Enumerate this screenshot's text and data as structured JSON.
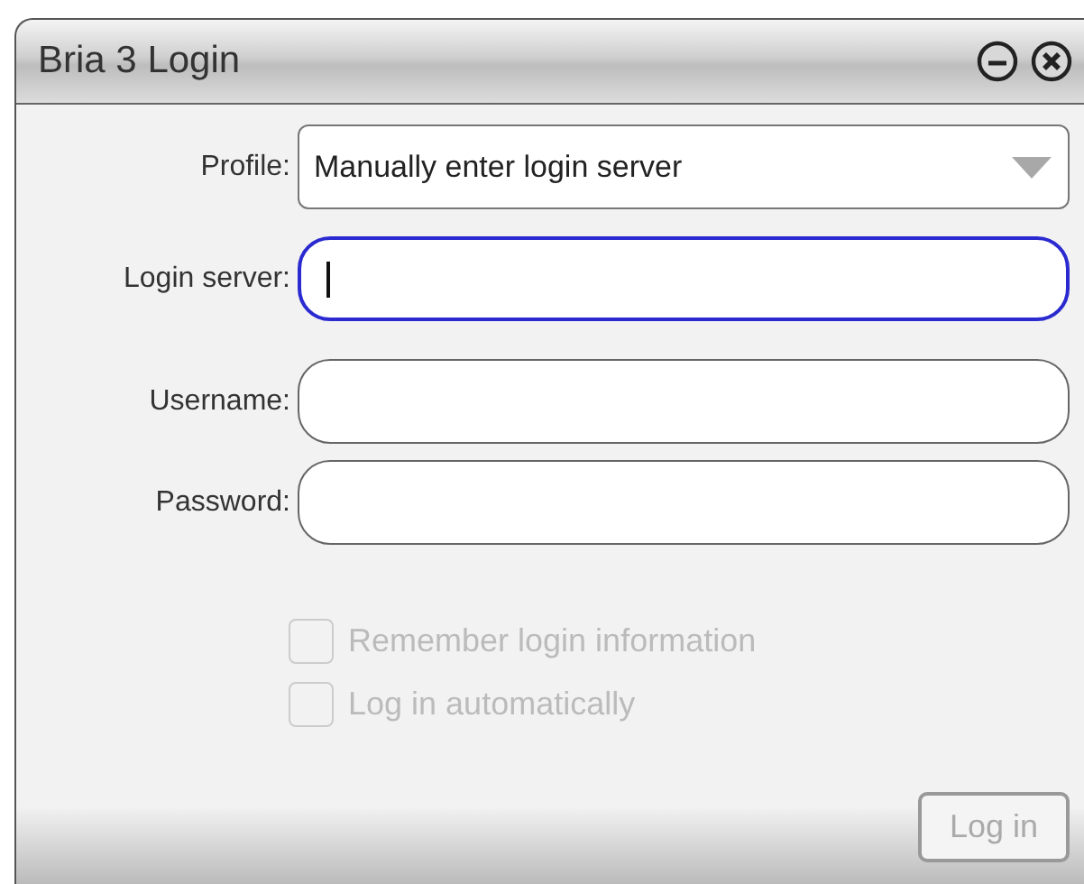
{
  "window": {
    "title": "Bria 3 Login"
  },
  "fields": [
    {
      "kind": "select",
      "label": "Profile:",
      "value": "Manually enter login server",
      "focused": false
    },
    {
      "kind": "text",
      "label": "Login server:",
      "focused": true
    },
    {
      "kind": "text",
      "label": "Username:",
      "focused": false
    },
    {
      "kind": "text",
      "label": "Password:",
      "focused": false
    }
  ],
  "checkboxes": [
    {
      "label": "Remember login information",
      "checked": false,
      "disabled": true
    },
    {
      "label": "Log in automatically",
      "checked": false,
      "disabled": true
    }
  ],
  "button": {
    "label": "Log in",
    "disabled": true
  }
}
